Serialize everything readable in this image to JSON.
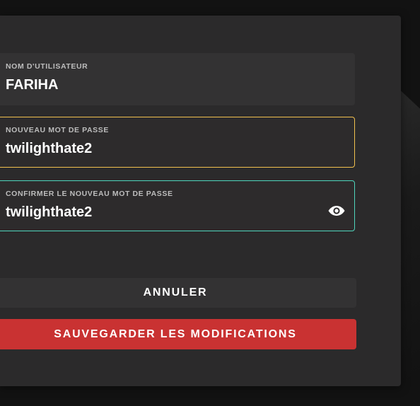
{
  "form": {
    "username": {
      "label": "NOM D'UTILISATEUR",
      "value": "FARIHA"
    },
    "new_password": {
      "label": "NOUVEAU MOT DE PASSE",
      "value": "twilighthate2",
      "accent": "#f2c14e"
    },
    "confirm_password": {
      "label": "CONFIRMER LE NOUVEAU MOT DE PASSE",
      "value": "twilighthate2",
      "accent": "#4fd6bd",
      "icon": "eye-icon"
    }
  },
  "actions": {
    "cancel_label": "ANNULER",
    "save_label": "SAUVEGARDER LES MODIFICATIONS",
    "save_color": "#c93232"
  }
}
